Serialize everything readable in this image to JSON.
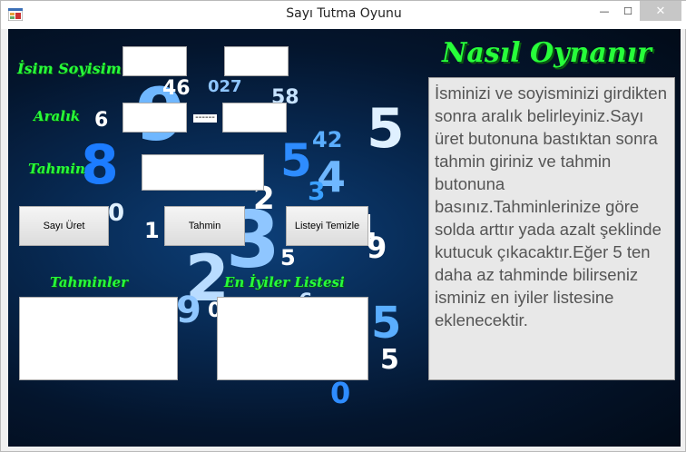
{
  "window": {
    "title": "Sayı Tutma Oyunu",
    "close_glyph": "✕",
    "min_glyph": "—",
    "max_glyph": "☐"
  },
  "labels": {
    "name": "İsim Soyisim",
    "range": "Aralık",
    "guess": "Tahmin",
    "guesses": "Tahminler",
    "best_list": "En İyiler Listesi",
    "range_separator": "------"
  },
  "inputs": {
    "first_name": "",
    "last_name": "",
    "range_min": "",
    "range_max": "",
    "guess": ""
  },
  "buttons": {
    "generate": "Sayı Üret",
    "guess": "Tahmin",
    "clear_list": "Listeyi Temizle"
  },
  "help": {
    "title": "Nasıl Oynanır",
    "text": "İsminizi ve soyisminizi girdikten sonra aralık belirleyiniz.Sayı üret butonuna bastıktan sonra tahmin giriniz ve tahmin butonuna basınız.Tahminlerinize göre solda arttır yada azalt şeklinde kutucuk çıkacaktır.Eğer 5 ten daha az tahminde bilirseniz isminiz en iyiler listesine eklenecektir."
  },
  "colors": {
    "label_green": "#27ff3a",
    "bg_dark": "#04152d",
    "digit_blue": "#3aa0ff"
  },
  "icons": {
    "app": "app-icon"
  }
}
